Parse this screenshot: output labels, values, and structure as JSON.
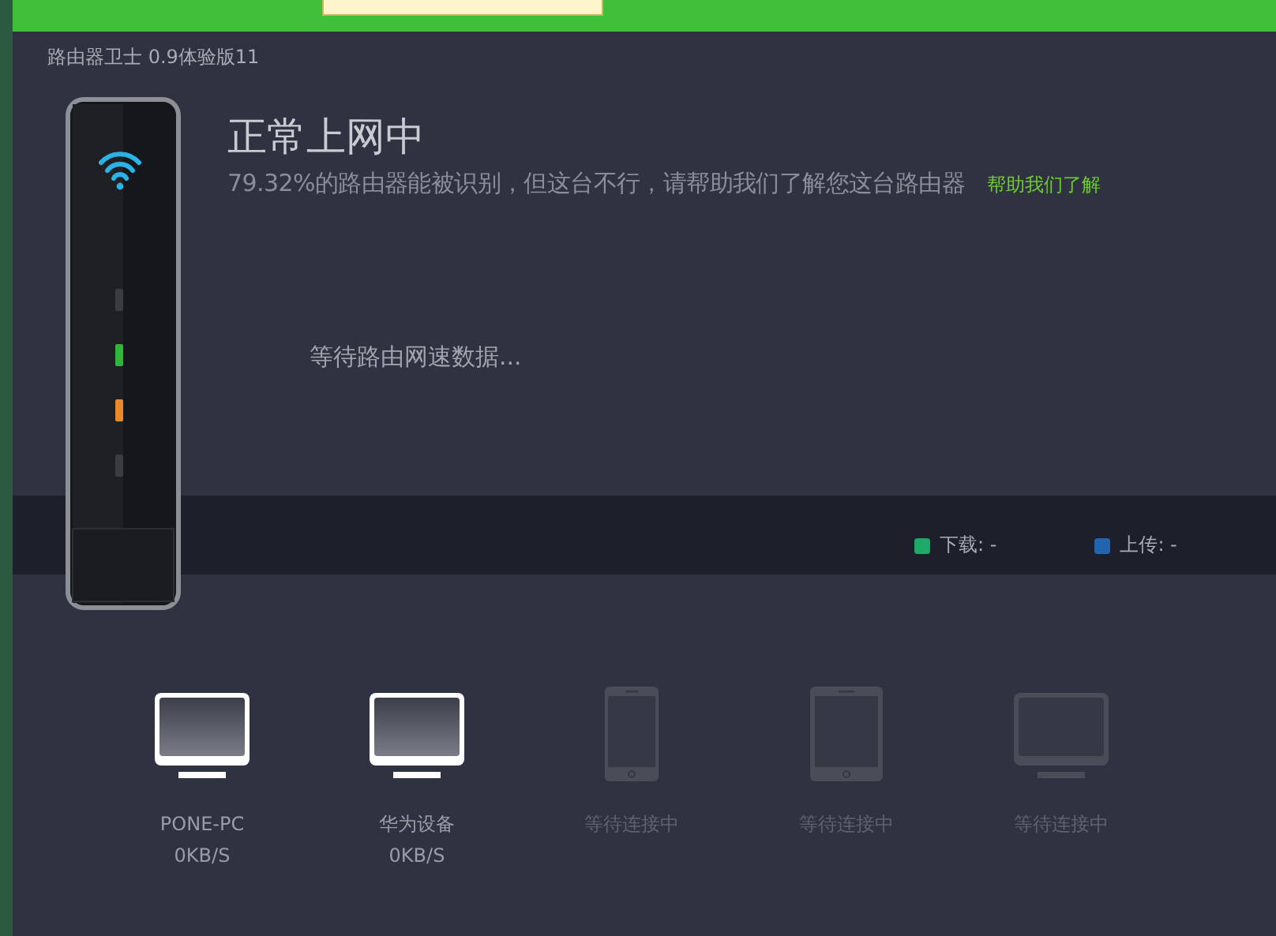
{
  "window": {
    "title": "路由器卫士 0.9体验版11"
  },
  "status": {
    "headline": "正常上网中",
    "message": "79.32%的路由器能被识别，但这台不行，请帮助我们了解您这台路由器",
    "help_link": "帮助我们了解"
  },
  "router": {
    "leds": [
      {
        "color": "#3a3c40"
      },
      {
        "color": "#2fb53a"
      },
      {
        "color": "#e8892a"
      },
      {
        "color": "#3a3c40"
      }
    ]
  },
  "speed": {
    "waiting": "等待路由网速数据...",
    "legend": [
      {
        "label": "下载: -",
        "color": "#1fa968"
      },
      {
        "label": "上传: -",
        "color": "#2164b0"
      }
    ]
  },
  "devices": [
    {
      "kind": "monitor",
      "connected": true,
      "name": "PONE-PC",
      "speed": "0KB/S"
    },
    {
      "kind": "monitor",
      "connected": true,
      "name": "华为设备",
      "speed": "0KB/S"
    },
    {
      "kind": "phone",
      "connected": false,
      "name": "等待连接中"
    },
    {
      "kind": "tablet",
      "connected": false,
      "name": "等待连接中"
    },
    {
      "kind": "monitor",
      "connected": false,
      "name": "等待连接中"
    }
  ]
}
